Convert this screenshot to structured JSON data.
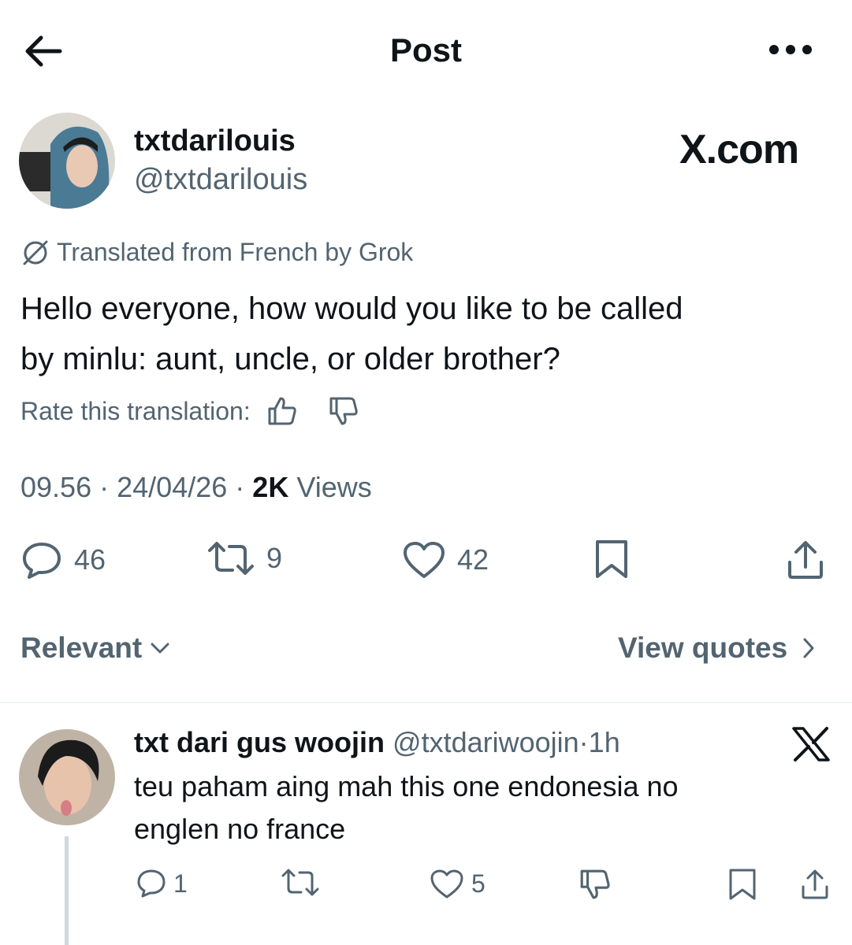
{
  "header": {
    "title": "Post",
    "back_icon": "arrow-left-icon",
    "more_icon": "more-dots-icon"
  },
  "author": {
    "name": "txtdarilouis",
    "handle": "@txtdarilouis",
    "watermark": "X.com"
  },
  "translation": {
    "label": "Translated from French by Grok",
    "icon": "grok-icon"
  },
  "post": {
    "text_line1": "Hello everyone, how would you like to be called",
    "text_line2": "by minlu: aunt, uncle, or older brother?"
  },
  "rate": {
    "label": "Rate this translation:"
  },
  "meta": {
    "time": "09.56",
    "date": "24/04/26",
    "views_count": "2K",
    "views_label": "Views",
    "separator": "·"
  },
  "actions": {
    "replies": "46",
    "reposts": "9",
    "likes": "42"
  },
  "filter": {
    "sort_label": "Relevant",
    "quotes_label": "View quotes"
  },
  "reply": {
    "name": "txt dari gus woojin",
    "handle": "@txtdariwoojin",
    "separator": "·",
    "time": "1h",
    "text_line1": "teu paham aing mah this one endonesia no",
    "text_line2": "englen no france",
    "actions": {
      "replies": "1",
      "likes": "5"
    }
  },
  "colors": {
    "text": "#0f1419",
    "secondary": "#536471",
    "divider": "#eff3f4",
    "thread_line": "#cfd9de"
  }
}
